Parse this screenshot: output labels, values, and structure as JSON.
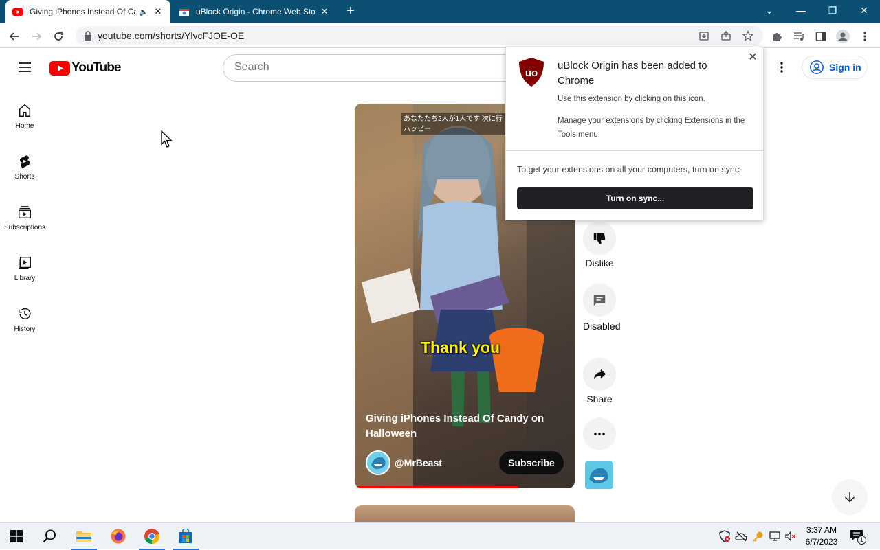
{
  "browser": {
    "tabs": [
      {
        "title": "Giving iPhones Instead Of Candy on Halloween - YouTube",
        "active": true,
        "audio": true
      },
      {
        "title": "uBlock Origin - Chrome Web Store",
        "active": false
      }
    ],
    "url": "youtube.com/shorts/YlvcFJOE-OE"
  },
  "youtube": {
    "logo_text": "YouTube",
    "search_placeholder": "Search",
    "sign_in_label": "Sign in",
    "guide": [
      {
        "label": "Home",
        "icon": "home-icon"
      },
      {
        "label": "Shorts",
        "icon": "shorts-icon"
      },
      {
        "label": "Subscriptions",
        "icon": "subscriptions-icon"
      },
      {
        "label": "Library",
        "icon": "library-icon"
      },
      {
        "label": "History",
        "icon": "history-icon"
      }
    ],
    "short": {
      "overlay_text_line1": "あなたたち2人が1人です 次に行",
      "overlay_text_line2": "ハッピー",
      "caption": "Thank you",
      "title": "Giving iPhones Instead Of Candy on Halloween",
      "channel": "@MrBeast",
      "subscribe_label": "Subscribe",
      "progress": 0.74
    },
    "actions": {
      "dislike_label": "Dislike",
      "comments_label": "Disabled",
      "share_label": "Share"
    }
  },
  "extension_popup": {
    "heading": "uBlock Origin has been added to Chrome",
    "line1": "Use this extension by clicking on this icon.",
    "line2": "Manage your extensions by clicking Extensions in the Tools menu.",
    "sync_text": "To get your extensions on all your computers, turn on sync",
    "sync_button": "Turn on sync..."
  },
  "taskbar": {
    "time": "3:37 AM",
    "date": "6/7/2023",
    "notification_count": "1"
  },
  "colors": {
    "tabstrip": "#0b4f72",
    "youtube_red": "#ff0000",
    "link_blue": "#065fd4",
    "ublock_red": "#800000"
  }
}
